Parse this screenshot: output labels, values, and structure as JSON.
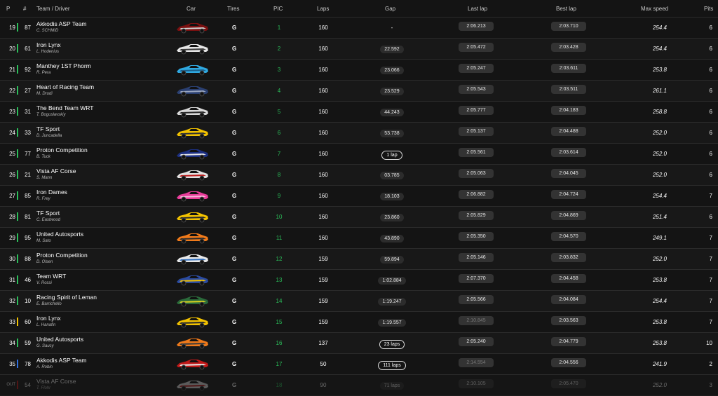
{
  "columns": {
    "pos": "P",
    "num": "#",
    "team_driver": "Team / Driver",
    "car": "Car",
    "tires": "Tires",
    "pic": "PIC",
    "laps": "Laps",
    "gap": "Gap",
    "last_lap": "Last lap",
    "best_lap": "Best lap",
    "max_speed": "Max speed",
    "pits": "Pits"
  },
  "rows": [
    {
      "pos": "19",
      "num": "87",
      "class_color": "#2bbf5a",
      "team": "Akkodis ASP Team",
      "driver": "C. SCHMID",
      "car_colors": [
        "#7a1010",
        "#d0d0d0"
      ],
      "tire": "G",
      "pic": "1",
      "laps": "160",
      "gap": "-",
      "gap_type": "text",
      "last": "2:06.213",
      "best": "2:03.710",
      "speed": "254.4",
      "pits": "6"
    },
    {
      "pos": "20",
      "num": "61",
      "class_color": "#2bbf5a",
      "team": "Iron Lynx",
      "driver": "L. Hodenius",
      "car_colors": [
        "#e6e6e6",
        "#3a3a3a"
      ],
      "tire": "G",
      "pic": "2",
      "laps": "160",
      "gap": "22.592",
      "gap_type": "pill",
      "last": "2:05.472",
      "best": "2:03.428",
      "speed": "254.4",
      "pits": "6"
    },
    {
      "pos": "21",
      "num": "92",
      "class_color": "#2bbf5a",
      "team": "Manthey 1ST Phorm",
      "driver": "R. Pera",
      "car_colors": [
        "#2fa8e0",
        "#1a5f8a"
      ],
      "tire": "G",
      "pic": "3",
      "laps": "160",
      "gap": "23.066",
      "gap_type": "pill",
      "last": "2:05.247",
      "best": "2:03.611",
      "speed": "253.8",
      "pits": "6"
    },
    {
      "pos": "22",
      "num": "27",
      "class_color": "#2bbf5a",
      "team": "Heart of Racing Team",
      "driver": "M. Drudi",
      "car_colors": [
        "#2a3f70",
        "#9aa6c0"
      ],
      "tire": "G",
      "pic": "4",
      "laps": "160",
      "gap": "23.529",
      "gap_type": "pill",
      "last": "2:05.543",
      "best": "2:03.511",
      "speed": "261.1",
      "pits": "6"
    },
    {
      "pos": "23",
      "num": "31",
      "class_color": "#2bbf5a",
      "team": "The Bend Team WRT",
      "driver": "T. Boguslavskiy",
      "car_colors": [
        "#d8d8d8",
        "#2a2a2a"
      ],
      "tire": "G",
      "pic": "5",
      "laps": "160",
      "gap": "44.243",
      "gap_type": "pill",
      "last": "2:05.777",
      "best": "2:04.183",
      "speed": "258.8",
      "pits": "6"
    },
    {
      "pos": "24",
      "num": "33",
      "class_color": "#2bbf5a",
      "team": "TF Sport",
      "driver": "D. Juncadella",
      "car_colors": [
        "#f2c200",
        "#333333"
      ],
      "tire": "G",
      "pic": "6",
      "laps": "160",
      "gap": "53.738",
      "gap_type": "pill",
      "last": "2:05.137",
      "best": "2:04.488",
      "speed": "252.0",
      "pits": "6"
    },
    {
      "pos": "25",
      "num": "77",
      "class_color": "#2bbf5a",
      "team": "Proton Competition",
      "driver": "B. Tuck",
      "car_colors": [
        "#1c2f80",
        "#e8e8e8"
      ],
      "tire": "G",
      "pic": "7",
      "laps": "160",
      "gap": "1 lap",
      "gap_type": "lap",
      "last": "2:05.561",
      "best": "2:03.614",
      "speed": "252.0",
      "pits": "6"
    },
    {
      "pos": "26",
      "num": "21",
      "class_color": "#2bbf5a",
      "team": "Vista AF Corse",
      "driver": "S. Mann",
      "car_colors": [
        "#e0e0e0",
        "#c01818"
      ],
      "tire": "G",
      "pic": "8",
      "laps": "160",
      "gap": "03.785",
      "gap_type": "pill",
      "last": "2:05.063",
      "best": "2:04.045",
      "speed": "252.0",
      "pits": "6"
    },
    {
      "pos": "27",
      "num": "85",
      "class_color": "#2bbf5a",
      "team": "Iron Dames",
      "driver": "R. Frey",
      "car_colors": [
        "#e83c9a",
        "#f4b8d8"
      ],
      "tire": "G",
      "pic": "9",
      "laps": "160",
      "gap": "18.103",
      "gap_type": "pill",
      "last": "2:06.882",
      "best": "2:04.724",
      "speed": "254.4",
      "pits": "7"
    },
    {
      "pos": "28",
      "num": "81",
      "class_color": "#2bbf5a",
      "team": "TF Sport",
      "driver": "C. Eastwood",
      "car_colors": [
        "#f2c200",
        "#2a2a2a"
      ],
      "tire": "G",
      "pic": "10",
      "laps": "160",
      "gap": "23.860",
      "gap_type": "pill",
      "last": "2:05.829",
      "best": "2:04.869",
      "speed": "251.4",
      "pits": "6"
    },
    {
      "pos": "29",
      "num": "95",
      "class_color": "#2bbf5a",
      "team": "United Autosports",
      "driver": "M. Sato",
      "car_colors": [
        "#f07a1a",
        "#2a2a2a"
      ],
      "tire": "G",
      "pic": "11",
      "laps": "160",
      "gap": "43.890",
      "gap_type": "pill",
      "last": "2:05.350",
      "best": "2:04.570",
      "speed": "249.1",
      "pits": "7"
    },
    {
      "pos": "30",
      "num": "88",
      "class_color": "#2bbf5a",
      "team": "Proton Competition",
      "driver": "D. Olsen",
      "car_colors": [
        "#e8e8e8",
        "#3070c0"
      ],
      "tire": "G",
      "pic": "12",
      "laps": "159",
      "gap": "59.894",
      "gap_type": "pill",
      "last": "2:05.146",
      "best": "2:03.832",
      "speed": "252.0",
      "pits": "7"
    },
    {
      "pos": "31",
      "num": "46",
      "class_color": "#2bbf5a",
      "team": "Team WRT",
      "driver": "V. Rossi",
      "car_colors": [
        "#2a4aa0",
        "#f2c200"
      ],
      "tire": "G",
      "pic": "13",
      "laps": "159",
      "gap": "1:02.884",
      "gap_type": "pill",
      "last": "2:07.370",
      "best": "2:04.458",
      "speed": "253.8",
      "pits": "7"
    },
    {
      "pos": "32",
      "num": "10",
      "class_color": "#2bbf5a",
      "team": "Racing Spirit of Leman",
      "driver": "E. Barrichello",
      "car_colors": [
        "#2a6a3a",
        "#d8d020"
      ],
      "tire": "G",
      "pic": "14",
      "laps": "159",
      "gap": "1:19.247",
      "gap_type": "pill",
      "last": "2:05.566",
      "best": "2:04.084",
      "speed": "254.4",
      "pits": "7"
    },
    {
      "pos": "33",
      "num": "60",
      "class_color": "#f2c200",
      "team": "Iron Lynx",
      "driver": "L. Hanafin",
      "car_colors": [
        "#f2c200",
        "#2a2a2a"
      ],
      "tire": "G",
      "pic": "15",
      "laps": "159",
      "gap": "1:19.557",
      "gap_type": "pill",
      "last": "2:10.845",
      "last_slow": true,
      "best": "2:03.563",
      "speed": "253.8",
      "pits": "7"
    },
    {
      "pos": "34",
      "num": "59",
      "class_color": "#2bbf5a",
      "team": "United Autosports",
      "driver": "G. Saucy",
      "car_colors": [
        "#f07a1a",
        "#3a3a3a"
      ],
      "tire": "G",
      "pic": "16",
      "laps": "137",
      "gap": "23 laps",
      "gap_type": "lap",
      "last": "2:05.240",
      "best": "2:04.779",
      "speed": "253.8",
      "pits": "10"
    },
    {
      "pos": "35",
      "num": "78",
      "class_color": "#3070e0",
      "team": "Akkodis ASP Team",
      "driver": "A. Robin",
      "car_colors": [
        "#c01818",
        "#e8e8e8"
      ],
      "tire": "G",
      "pic": "17",
      "laps": "50",
      "gap": "111 laps",
      "gap_type": "lap",
      "last": "2:14.554",
      "last_slow": true,
      "best": "2:04.556",
      "speed": "241.9",
      "pits": "2"
    },
    {
      "pos": "OUT",
      "num": "54",
      "class_color": "#c01818",
      "team": "Vista AF Corse",
      "driver": "T. Flohr",
      "car_colors": [
        "#e0e0e0",
        "#c01818"
      ],
      "tire": "G",
      "pic": "18",
      "laps": "90",
      "gap": "71 laps",
      "gap_type": "pill",
      "last": "2:10.105",
      "best": "2:05.470",
      "speed": "252.0",
      "pits": "3",
      "out": true
    }
  ]
}
